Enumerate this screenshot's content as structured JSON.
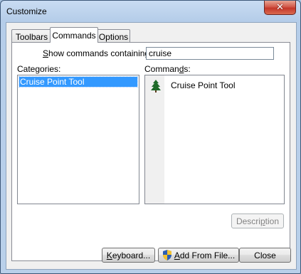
{
  "window": {
    "title": "Customize",
    "close_symbol": "✕"
  },
  "tabs": [
    {
      "label": "Toolbars"
    },
    {
      "label": "Commands"
    },
    {
      "label": "Options"
    }
  ],
  "search": {
    "label_prefix": "S",
    "label_rest": "how commands containing:",
    "value": "cruise"
  },
  "categories": {
    "label_prefix": "Cate",
    "label_accel": "g",
    "label_rest": "ories:",
    "items": [
      "Cruise Point Tool"
    ]
  },
  "commands": {
    "label_prefix": "Comman",
    "label_accel": "d",
    "label_rest": "s:",
    "items": [
      {
        "label": "Cruise Point Tool",
        "icon": "tree-icon"
      }
    ]
  },
  "buttons": {
    "description": {
      "prefix": "Descri",
      "accel": "p",
      "rest": "tion"
    },
    "keyboard": {
      "accel": "K",
      "rest": "eyboard..."
    },
    "add_from_file": {
      "accel": "A",
      "rest": "dd From File..."
    },
    "close": "Close"
  }
}
